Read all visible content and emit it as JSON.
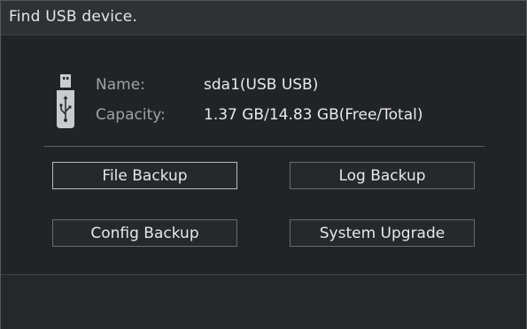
{
  "dialog": {
    "title": "Find USB device."
  },
  "device": {
    "icon": "usb-drive-icon",
    "name_label": "Name:",
    "name_value": "sda1(USB USB)",
    "capacity_label": "Capacity:",
    "capacity_value": "1.37 GB/14.83 GB(Free/Total)"
  },
  "buttons": {
    "file_backup": "File Backup",
    "log_backup": "Log Backup",
    "config_backup": "Config Backup",
    "system_upgrade": "System Upgrade"
  },
  "colors": {
    "background": "#212327",
    "title_bar": "#2f3135",
    "button_border": "#686b70",
    "focused_border": "#b9bcc0",
    "text": "#e6e8ea",
    "label_text": "#9ea2a7"
  }
}
